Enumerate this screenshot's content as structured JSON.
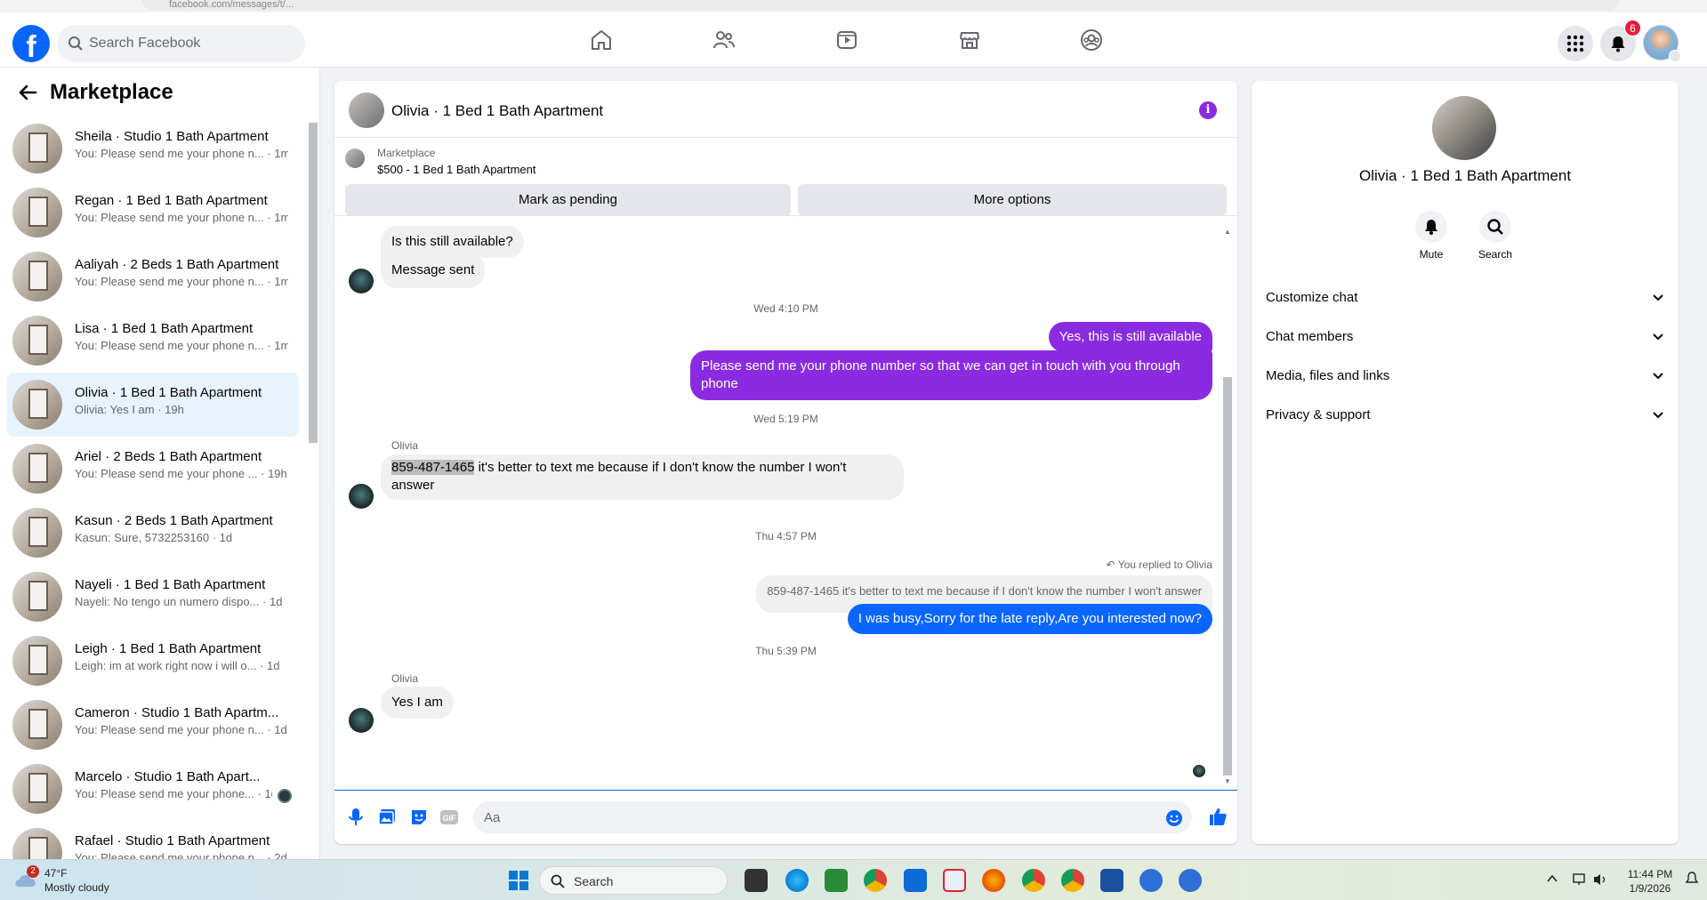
{
  "browser": {
    "url_fragment": "facebook.com/messages/t/..."
  },
  "nav": {
    "search_placeholder": "Search Facebook",
    "notification_count": "6",
    "icons": [
      "home-icon",
      "friends-icon",
      "video-icon",
      "marketplace-icon",
      "groups-icon"
    ],
    "accent": "#0866ff"
  },
  "sidebar": {
    "title": "Marketplace",
    "conversations": [
      {
        "title": "Sheila · Studio 1 Bath Apartment",
        "preview": "You: Please send me your phone n...",
        "time": "· 1m"
      },
      {
        "title": "Regan · 1 Bed 1 Bath Apartment",
        "preview": "You: Please send me your phone n...",
        "time": "· 1m"
      },
      {
        "title": "Aaliyah · 2 Beds 1 Bath Apartment",
        "preview": "You: Please send me your phone n...",
        "time": "· 1m"
      },
      {
        "title": "Lisa · 1 Bed 1 Bath Apartment",
        "preview": "You: Please send me your phone n...",
        "time": "· 1m"
      },
      {
        "title": "Olivia · 1 Bed 1 Bath Apartment",
        "preview": "Olivia: Yes I am",
        "time": "· 19h"
      },
      {
        "title": "Ariel · 2 Beds 1 Bath Apartment",
        "preview": "You: Please send me your phone ...",
        "time": "· 19h"
      },
      {
        "title": "Kasun · 2 Beds 1 Bath Apartment",
        "preview": "Kasun: Sure, 5732253160",
        "time": "· 1d"
      },
      {
        "title": "Nayeli · 1 Bed 1 Bath Apartment",
        "preview": "Nayeli: No tengo un numero dispo...",
        "time": "· 1d"
      },
      {
        "title": "Leigh · 1 Bed 1 Bath Apartment",
        "preview": "Leigh: im at work right now i will o...",
        "time": "· 1d"
      },
      {
        "title": "Cameron · Studio 1 Bath Apartm...",
        "preview": "You: Please send me your phone n...",
        "time": "· 1d"
      },
      {
        "title": "Marcelo · Studio 1 Bath Apart...",
        "preview": "You: Please send me your phone...",
        "time": "· 1d"
      },
      {
        "title": "Rafael · Studio 1 Bath Apartment",
        "preview": "You: Please send me your phone n...",
        "time": "· 2d"
      }
    ]
  },
  "chat": {
    "header_name": "Olivia · 1 Bed 1 Bath Apartment",
    "marketplace_label": "Marketplace",
    "listing": "$500 - 1 Bed 1 Bath Apartment",
    "mark_pending": "Mark as pending",
    "more_options": "More options",
    "messages": {
      "m1": "Is this still available?",
      "m2": "Message sent",
      "ts1": "Wed 4:10 PM",
      "m3": "Yes, this is still available",
      "m4_line1": "Please send me your phone  number so that we can get in touch with you through",
      "m4_line2": "phone",
      "ts2": "Wed 5:19 PM",
      "sender1": "Olivia",
      "m5_phone": "859-487-1465",
      "m5_rest": " it's better to text me because if I don't know the number I won't",
      "m5_line2": "answer",
      "ts3": "Thu 4:57 PM",
      "reply_note": "You replied to Olivia",
      "reply_quote": "859-487-1465 it's better to text me because if I don't know the number I won't answer",
      "m6": "I was busy,Sorry for the late reply,Are you interested now?",
      "ts4": "Thu 5:39 PM",
      "sender2": "Olivia",
      "m7": "Yes I am"
    },
    "compose_placeholder": "Aa",
    "outgoing_color": "#8a2be2",
    "reply_color": "#0a66ff"
  },
  "details": {
    "name": "Olivia · 1 Bed 1 Bath Apartment",
    "mute": "Mute",
    "search": "Search",
    "sections": [
      "Customize chat",
      "Chat members",
      "Media, files and links",
      "Privacy & support"
    ]
  },
  "taskbar": {
    "temp": "47°F",
    "weather": "Mostly cloudy",
    "weather_badge": "2",
    "search": "Search",
    "time": "11:44 PM",
    "date": "1/9/2026"
  }
}
